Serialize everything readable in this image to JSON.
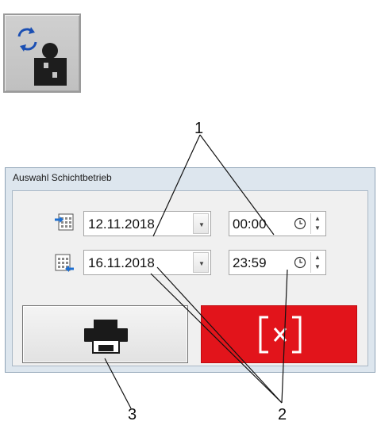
{
  "window": {
    "title": "Auswahl Schichtbetrieb"
  },
  "start": {
    "date": "12.11.2018",
    "time": "00:00"
  },
  "end": {
    "date": "16.11.2018",
    "time": "23:59"
  },
  "buttons": {
    "print_icon": "printer-icon",
    "cancel_icon": "x-bracket-icon"
  },
  "callouts": [
    "1",
    "2",
    "3"
  ],
  "colors": {
    "cancel": "#e2141b",
    "window_bg": "#dde6ee",
    "client_bg": "#f0f0f0"
  }
}
